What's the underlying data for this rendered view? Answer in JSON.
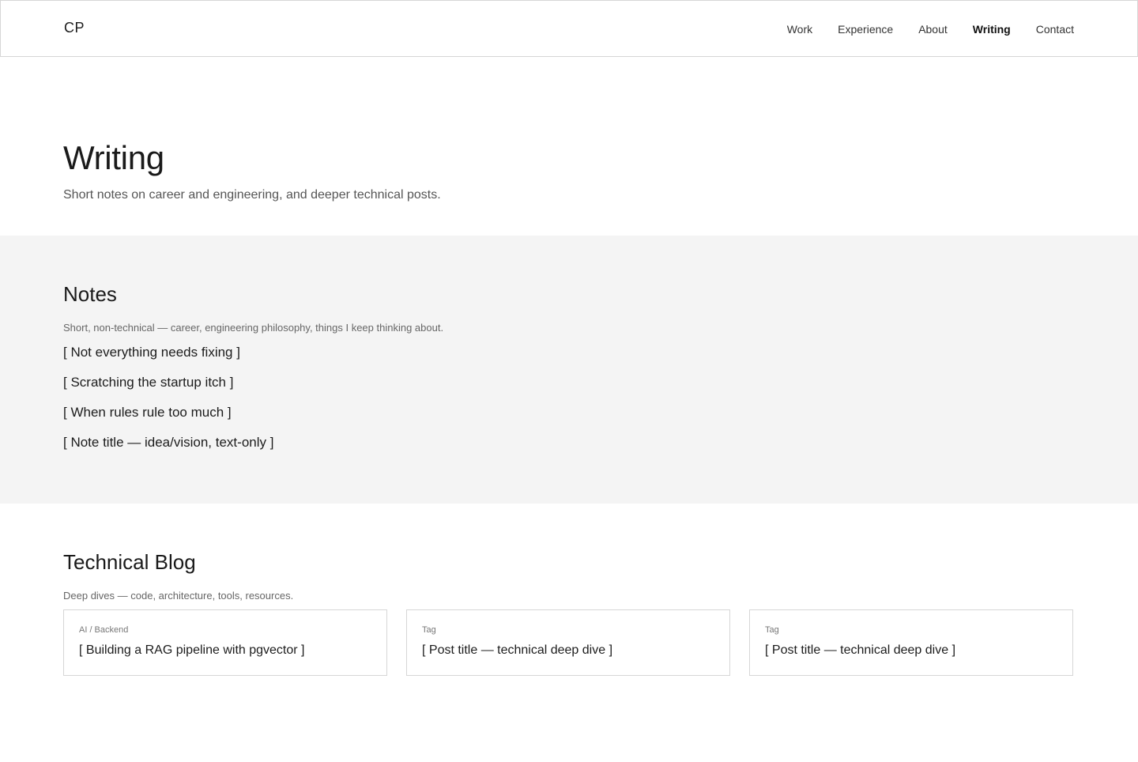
{
  "header": {
    "brand": "CP",
    "nav": [
      {
        "label": "Work"
      },
      {
        "label": "Experience"
      },
      {
        "label": "About"
      },
      {
        "label": "Writing",
        "active": true
      },
      {
        "label": "Contact"
      }
    ]
  },
  "hero": {
    "title": "Writing",
    "subtitle": "Short notes on career and engineering, and deeper technical posts."
  },
  "notes": {
    "title": "Notes",
    "description": "Short, non-technical — career, engineering philosophy, things I keep thinking about.",
    "items": [
      {
        "label": "[ Not everything needs fixing ]"
      },
      {
        "label": "[ Scratching the startup itch ]"
      },
      {
        "label": "[ When rules rule too much ]"
      },
      {
        "label": "[ Note title — idea/vision, text-only ]"
      }
    ]
  },
  "blog": {
    "title": "Technical Blog",
    "description": "Deep dives — code, architecture, tools, resources.",
    "cards": [
      {
        "tag": "AI / Backend",
        "title": "[ Building a RAG pipeline with pgvector ]"
      },
      {
        "tag": "Tag",
        "title": "[ Post title — technical deep dive ]"
      },
      {
        "tag": "Tag",
        "title": "[ Post title — technical deep dive ]"
      }
    ]
  },
  "colors": {
    "text": "#1c1c1c",
    "muted": "#555555",
    "border": "#d6d6d6",
    "notes_background": "#f4f4f4"
  }
}
